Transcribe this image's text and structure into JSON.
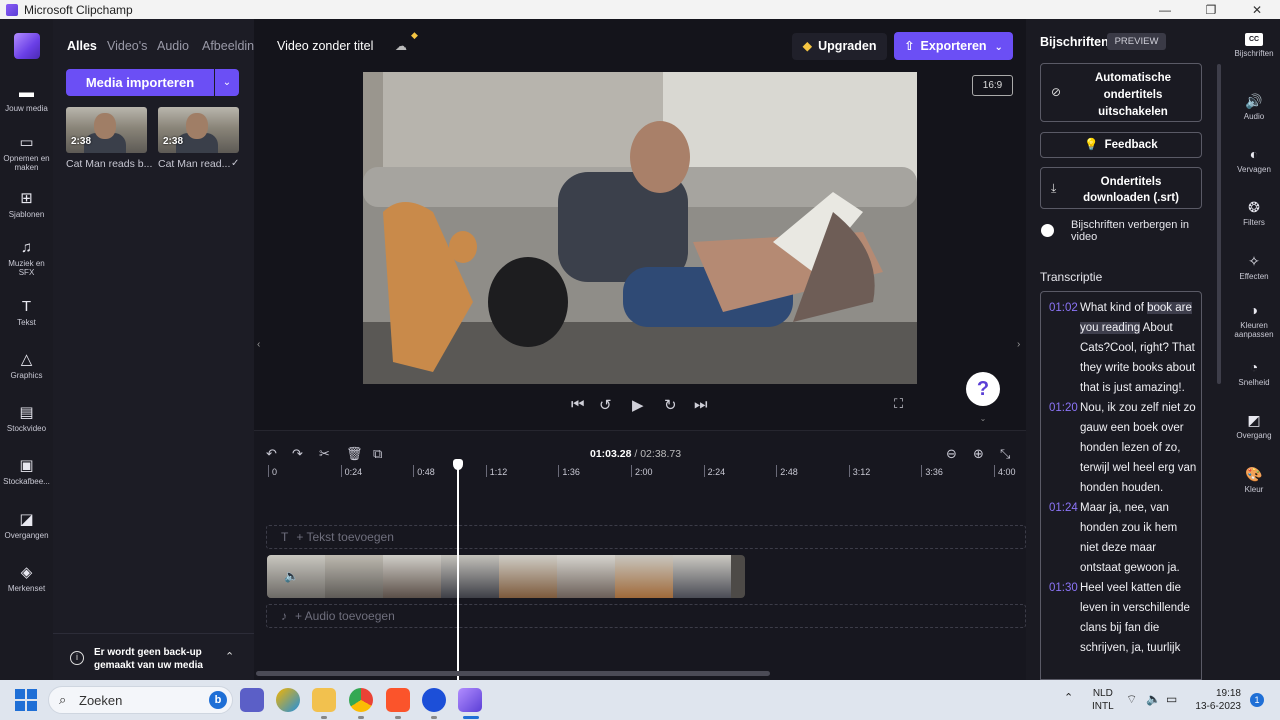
{
  "window": {
    "title": "Microsoft Clipchamp",
    "controls": [
      "—",
      "❐",
      "✕"
    ]
  },
  "left_rail": [
    {
      "label": "Jouw media",
      "icon": "folder-icon"
    },
    {
      "label": "Opnemen en maken",
      "icon": "camera-icon"
    },
    {
      "label": "Sjablonen",
      "icon": "templates-icon"
    },
    {
      "label": "Muziek en SFX",
      "icon": "music-icon"
    },
    {
      "label": "Tekst",
      "icon": "text-icon"
    },
    {
      "label": "Graphics",
      "icon": "shapes-icon"
    },
    {
      "label": "Stockvideo",
      "icon": "film-icon"
    },
    {
      "label": "Stockafbee...",
      "icon": "image-icon"
    },
    {
      "label": "Overgangen",
      "icon": "transitions-icon"
    },
    {
      "label": "Merkenset",
      "icon": "brand-kit-icon"
    }
  ],
  "media_panel": {
    "tabs": [
      "Alles",
      "Video's",
      "Audio",
      "Afbeeldin"
    ],
    "import_label": "Media importeren",
    "items": [
      {
        "duration": "2:38",
        "name": "Cat Man reads b..."
      },
      {
        "duration": "2:38",
        "name": "Cat Man read..."
      }
    ],
    "backup_text": "Er wordt geen back-up gemaakt van uw media"
  },
  "editor": {
    "project_title": "Video zonder titel",
    "upgrade_label": "Upgraden",
    "export_label": "Exporteren",
    "aspect_ratio": "16:9",
    "help_label": "?"
  },
  "timeline": {
    "current_time": "01:03.28",
    "total_time": "02:38.73",
    "ruler": [
      "0",
      "0:24",
      "0:48",
      "1:12",
      "1:36",
      "2:00",
      "2:24",
      "2:48",
      "3:12",
      "3:36",
      "4:00"
    ],
    "text_lane": "+ Tekst toevoegen",
    "audio_lane": "+ Audio toevoegen"
  },
  "captions": {
    "title": "Bijschriften",
    "badge": "PREVIEW",
    "auto_off": "Automatische ondertitels uitschakelen",
    "feedback": "Feedback",
    "download": "Ondertitels downloaden (.srt)",
    "hide_label": "Bijschriften verbergen in video",
    "transcript_title": "Transcriptie",
    "segments": [
      {
        "time": "01:02",
        "pre": "What kind of ",
        "hl": "book are you reading",
        "post": " About Cats?Cool, right? That they write books about that is just amazing!."
      },
      {
        "time": "01:20",
        "pre": "Nou, ik zou zelf niet zo gauw een boek over honden lezen of zo, terwijl wel heel erg van honden houden.",
        "hl": "",
        "post": ""
      },
      {
        "time": "01:24",
        "pre": "Maar ja, nee, van honden zou ik hem niet deze maar ontstaat gewoon ja.",
        "hl": "",
        "post": ""
      },
      {
        "time": "01:30",
        "pre": "Heel veel katten die leven in verschillende clans bij fan die schrijven, ja, tuurlijk",
        "hl": "",
        "post": ""
      }
    ]
  },
  "right_rail": [
    {
      "label": "Bijschriften",
      "icon": "captions-icon"
    },
    {
      "label": "Audio",
      "icon": "speaker-icon"
    },
    {
      "label": "Vervagen",
      "icon": "fade-icon"
    },
    {
      "label": "Filters",
      "icon": "filters-icon"
    },
    {
      "label": "Effecten",
      "icon": "magic-wand-icon"
    },
    {
      "label": "Kleuren aanpassen",
      "icon": "color-adjust-icon"
    },
    {
      "label": "Snelheid",
      "icon": "speedometer-icon"
    },
    {
      "label": "Overgang",
      "icon": "transition-icon"
    },
    {
      "label": "Kleur",
      "icon": "palette-icon"
    }
  ],
  "taskbar": {
    "search_label": "Zoeken",
    "lang_line1": "NLD",
    "lang_line2": "INTL",
    "time": "19:18",
    "date": "13-6-2023",
    "notifications": "1"
  },
  "colors": {
    "accent": "#6b4ff5",
    "timestamp": "#8b74f7",
    "gem": "#f5c542"
  }
}
